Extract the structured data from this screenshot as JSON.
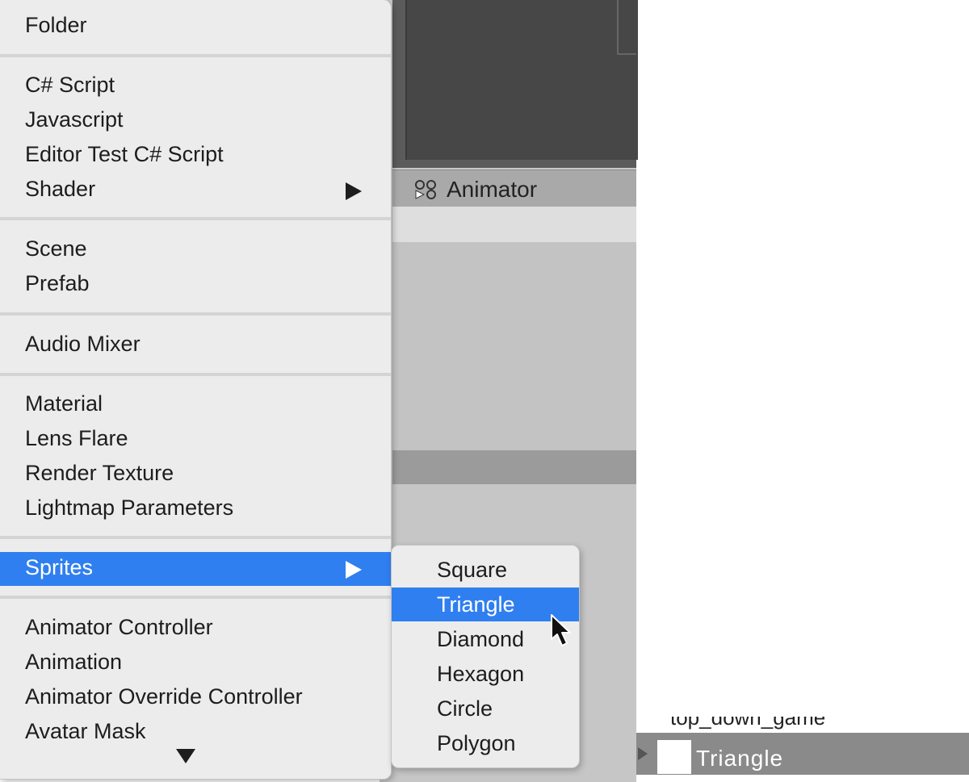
{
  "background": {
    "animator_tab": {
      "label": "Animator",
      "icon": "animator-icon"
    },
    "hierarchy": {
      "partial_item_label": "top_down_game",
      "selected_item_label": "Triangle",
      "expand_icon": "triangle-right-icon"
    }
  },
  "create_menu": {
    "groups": [
      [
        {
          "label": "Folder"
        }
      ],
      [
        {
          "label": "C# Script"
        },
        {
          "label": "Javascript"
        },
        {
          "label": "Editor Test C# Script"
        },
        {
          "label": "Shader",
          "submenu": true
        }
      ],
      [
        {
          "label": "Scene"
        },
        {
          "label": "Prefab"
        }
      ],
      [
        {
          "label": "Audio Mixer"
        }
      ],
      [
        {
          "label": "Material"
        },
        {
          "label": "Lens Flare"
        },
        {
          "label": "Render Texture"
        },
        {
          "label": "Lightmap Parameters"
        }
      ],
      [
        {
          "label": "Sprites",
          "submenu": true,
          "selected": true
        }
      ],
      [
        {
          "label": "Animator Controller"
        },
        {
          "label": "Animation"
        },
        {
          "label": "Animator Override Controller"
        },
        {
          "label": "Avatar Mask"
        }
      ]
    ],
    "scroll_indicator": "scroll-down-arrow-icon"
  },
  "sprites_submenu": {
    "items": [
      {
        "label": "Square"
      },
      {
        "label": "Triangle",
        "selected": true
      },
      {
        "label": "Diamond"
      },
      {
        "label": "Hexagon"
      },
      {
        "label": "Circle"
      },
      {
        "label": "Polygon"
      }
    ]
  },
  "colors": {
    "selection": "#2f7ff0",
    "menu_bg": "#ececec",
    "menu_text": "#1d1d1d"
  }
}
